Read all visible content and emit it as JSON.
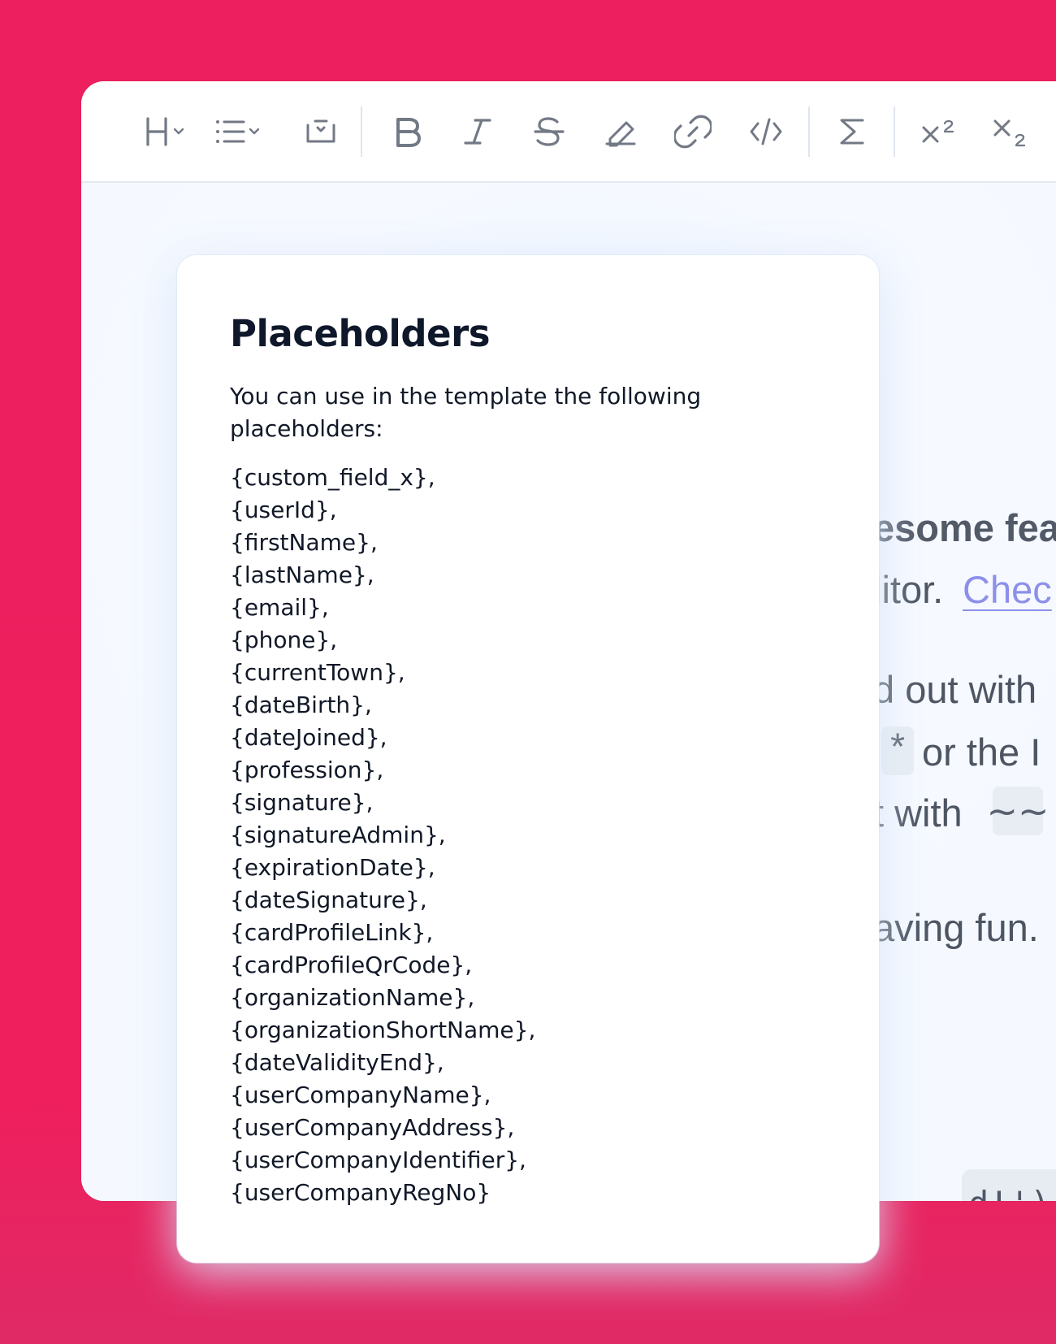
{
  "toolbar": {
    "tools": [
      {
        "name": "heading",
        "label": "H"
      },
      {
        "name": "bullet-list",
        "label": ""
      },
      {
        "name": "code-block",
        "label": ""
      },
      {
        "name": "bold",
        "label": "B"
      },
      {
        "name": "italic",
        "label": "I"
      },
      {
        "name": "strikethrough",
        "label": "S"
      },
      {
        "name": "highlight",
        "label": ""
      },
      {
        "name": "link",
        "label": ""
      },
      {
        "name": "inline-code",
        "label": "</>"
      },
      {
        "name": "math",
        "label": "Σ"
      },
      {
        "name": "superscript",
        "label": "x²"
      },
      {
        "name": "subscript",
        "label": "x₂"
      }
    ]
  },
  "background_editor": {
    "visible_fragments": {
      "heading": "esome fea",
      "line_1_text": "litor.",
      "line_1_link": "Chec",
      "line_2": "d out with",
      "line_3_code": "*",
      "line_3_text": "or the I",
      "line_4_text": "t with",
      "line_4_code": "~~",
      "line_5": "aving fun.",
      "code_block": "d!');"
    }
  },
  "modal": {
    "title": "Placeholders",
    "description": "You can use in the template the following placeholders:",
    "placeholders": [
      "{custom_field_x},",
      "{userId},",
      "{firstName},",
      "{lastName},",
      "{email},",
      "{phone},",
      "{currentTown},",
      "{dateBirth},",
      "{dateJoined},",
      "{profession},",
      "{signature},",
      "{signatureAdmin},",
      "{expirationDate},",
      "{dateSignature},",
      "{cardProfileLink},",
      "{cardProfileQrCode},",
      "{organizationName},",
      "{organizationShortName},",
      "{dateValidityEnd},",
      "{userCompanyName},",
      "{userCompanyAddress},",
      "{userCompanyIdentifier},",
      "{userCompanyRegNo}"
    ]
  },
  "colors": {
    "page_background": "#ee1f5e",
    "editor_background": "#f5f9ff",
    "modal_background": "#ffffff",
    "text_primary": "#111827",
    "link": "#8c90ea"
  }
}
